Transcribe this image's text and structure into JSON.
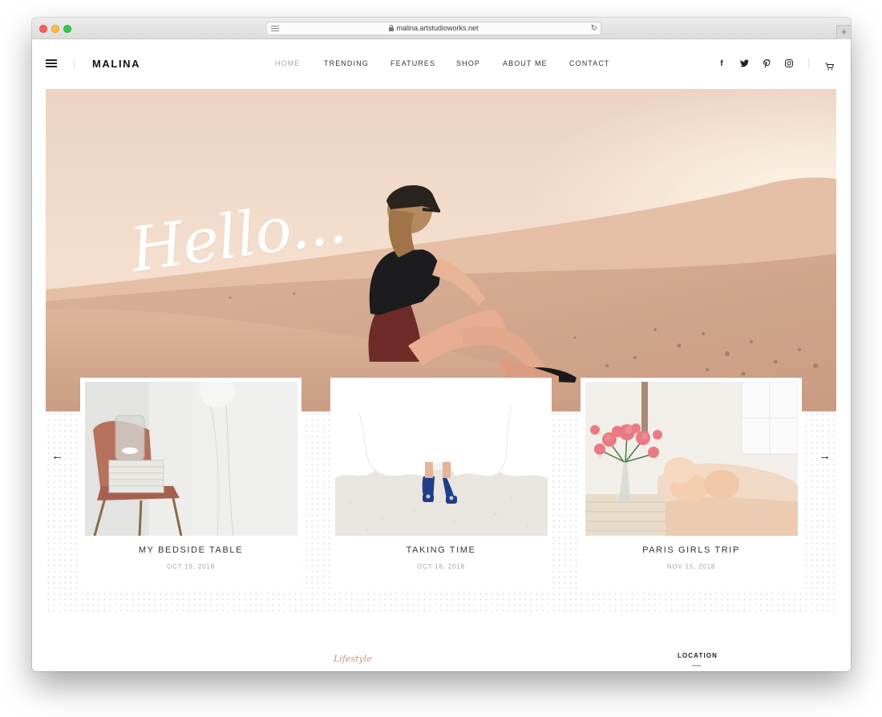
{
  "browser": {
    "url": "malina.artstudioworks.net",
    "new_tab": "+",
    "reload": "↻"
  },
  "header": {
    "logo": "MALINA",
    "nav": [
      {
        "label": "HOME",
        "active": true
      },
      {
        "label": "TRENDING",
        "active": false
      },
      {
        "label": "FEATURES",
        "active": false
      },
      {
        "label": "SHOP",
        "active": false
      },
      {
        "label": "ABOUT ME",
        "active": false
      },
      {
        "label": "CONTACT",
        "active": false
      }
    ],
    "social": {
      "facebook": "f",
      "twitter": "t",
      "pinterest": "p",
      "instagram": "◎"
    }
  },
  "hero": {
    "greeting": "Hello..."
  },
  "slider": {
    "prev": "←",
    "next": "→",
    "posts": [
      {
        "title": "MY BEDSIDE TABLE",
        "date": "OCT 19, 2018"
      },
      {
        "title": "TAKING TIME",
        "date": "OCT 16, 2018"
      },
      {
        "title": "PARIS GIRLS TRIP",
        "date": "NOV 15, 2018"
      }
    ]
  },
  "below": {
    "category": "Lifestyle",
    "widget_title": "LOCATION"
  },
  "colors": {
    "accent": "#c9937b",
    "nav_active": "#a5a5a5",
    "text": "#333333"
  }
}
